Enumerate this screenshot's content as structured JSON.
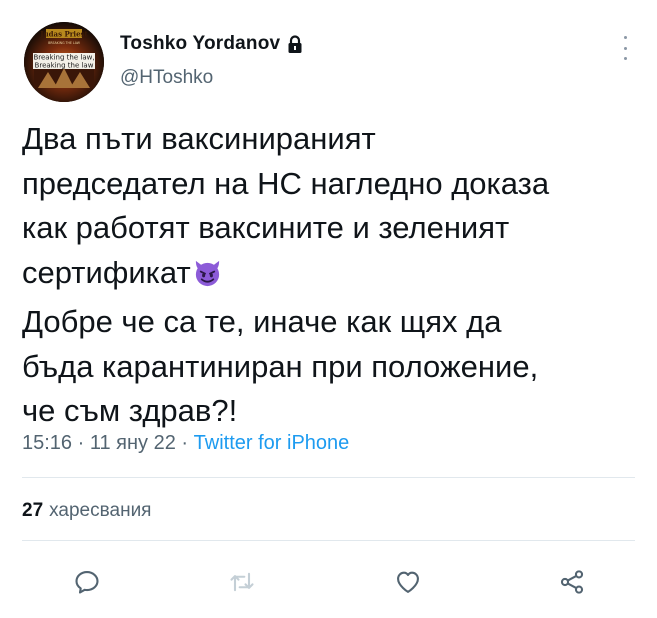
{
  "author": {
    "display_name": "Toshko Yordanov",
    "handle": "@HToshko",
    "protected_icon": "lock-icon",
    "avatar": {
      "icon": "band-poster-avatar",
      "logo_text": "Judas Priest",
      "tagline": "BREAKING THE LAW",
      "caption_1": "Breaking the law,",
      "caption_2": "Breaking the law"
    }
  },
  "tweet": {
    "lines": [
      "Два пъти ваксинираният",
      "председател на НС нагледно доказа",
      "как работят ваксините и зеленият",
      "сертификат",
      "Добре че са те, иначе как щях да",
      "бъда карантиниран при положение,",
      "че съм здрав?!"
    ],
    "emoji": "smiling-face-with-horns-emoji"
  },
  "meta": {
    "time": "15:16",
    "separator": "·",
    "date": "11 яну 22",
    "source": "Twitter for iPhone"
  },
  "stats": {
    "likes_count": "27",
    "likes_label": "харесвания"
  },
  "actions": [
    "reply-icon",
    "retweet-icon",
    "like-icon",
    "share-icon"
  ],
  "colors": {
    "text": "#0f1419",
    "secondary": "#536471",
    "link": "#1d9bf0",
    "emoji": "#8c5bd8"
  }
}
